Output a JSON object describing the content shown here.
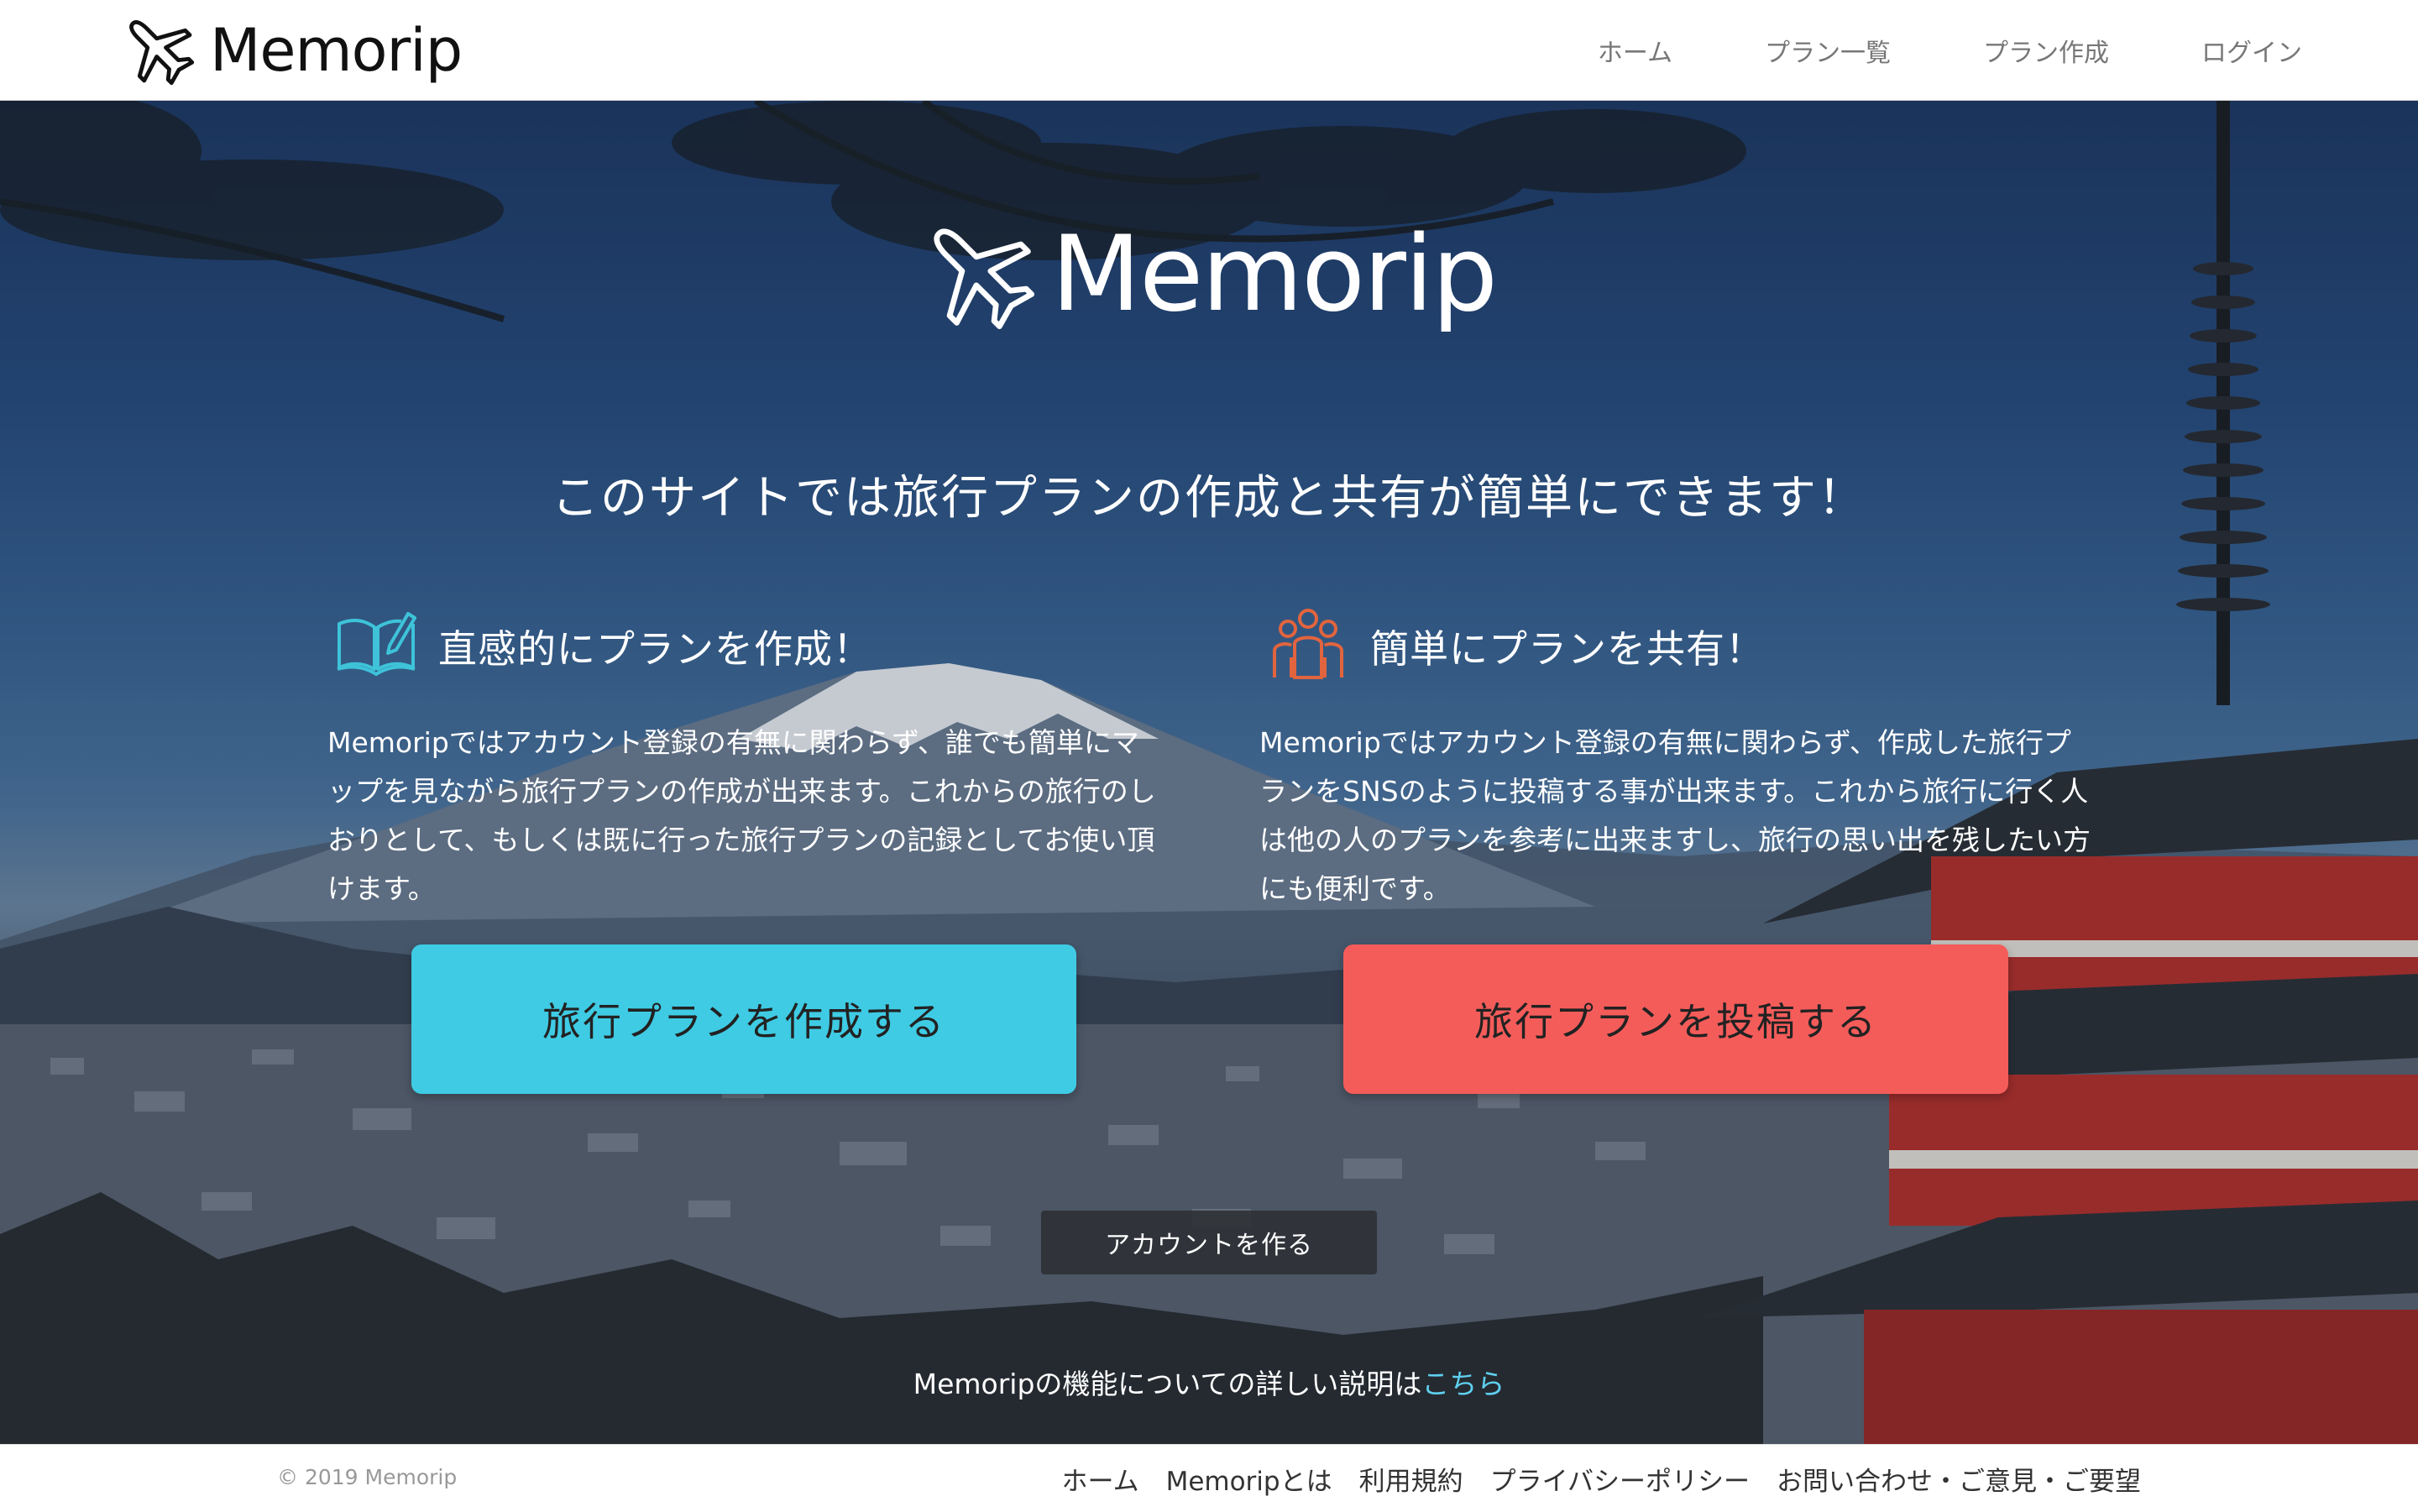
{
  "navbar": {
    "brand": "Memorip",
    "links": [
      "ホーム",
      "プラン一覧",
      "プラン作成",
      "ログイン"
    ]
  },
  "hero": {
    "logo_text": "Memorip",
    "tagline": "このサイトでは旅行プランの作成と共有が簡単にできます！",
    "features": [
      {
        "icon": "open-book-pencil-icon",
        "title": "直感的にプランを作成！",
        "body": "Memoripではアカウント登録の有無に関わらず、誰でも簡単にマップを見ながら旅行プランの作成が出来ます。これからの旅行のしおりとして、もしくは既に行った旅行プランの記録としてお使い頂けます。"
      },
      {
        "icon": "group-users-icon",
        "title": "簡単にプランを共有！",
        "body": "Memoripではアカウント登録の有無に関わらず、作成した旅行プランをSNSのように投稿する事が出来ます。これから旅行に行く人は他の人のプランを参考に出来ますし、旅行の思い出を残したい方にも便利です。"
      }
    ],
    "cta_create": "旅行プランを作成する",
    "cta_post": "旅行プランを投稿する",
    "account_button": "アカウントを作る",
    "detail_text": "Memoripの機能についての詳しい説明は",
    "detail_link": "こちら"
  },
  "footer": {
    "copyright": "© 2019 Memorip",
    "links": [
      "ホーム",
      "Memoripとは",
      "利用規約",
      "プライバシーポリシー",
      "お問い合わせ・ご意見・ご要望"
    ]
  },
  "colors": {
    "create_button": "#3fcbe4",
    "post_button": "#f45c5a",
    "book_icon": "#3ec3d9",
    "users_icon": "#e2643e",
    "detail_link": "#5fd0ef"
  }
}
